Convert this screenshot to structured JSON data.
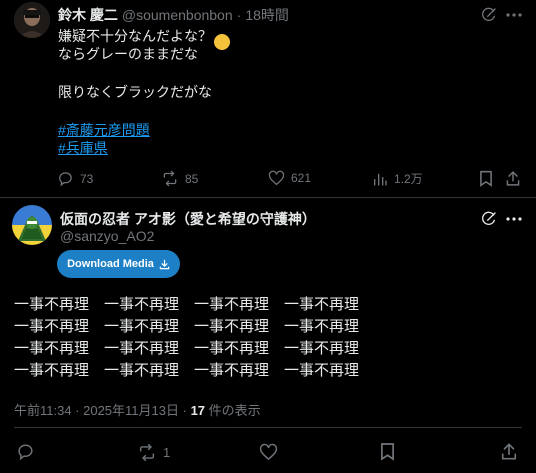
{
  "tweet1": {
    "display_name": "鈴木 慶二",
    "handle": "@soumenbonbon",
    "separator": "·",
    "time": "18時間",
    "line1": "嫌疑不十分なんだよな？",
    "line1_emoji": "🤔",
    "line2": "ならグレーのままだな",
    "line3": "限りなくブラックだがな",
    "hashtag1": "#斎藤元彦問題",
    "hashtag2": "#兵庫県",
    "replies": "73",
    "reposts": "85",
    "likes": "621",
    "views": "1.2万"
  },
  "tweet2": {
    "display_name": "仮面の忍者 アオ影（愛と希望の守護神）",
    "handle": "@sanzyo_AO2",
    "download_label": "Download Media",
    "body_lines": [
      "一事不再理　一事不再理　一事不再理　一事不再理",
      "一事不再理　一事不再理　一事不再理　一事不再理",
      "一事不再理　一事不再理　一事不再理　一事不再理",
      "一事不再理　一事不再理　一事不再理　一事不再理"
    ],
    "timestamp": "午前11:34 · 2025年11月13日 · ",
    "view_count": "17",
    "view_suffix": " 件の表示",
    "reposts": "1"
  },
  "colors": {
    "background": "#000000",
    "text": "#e7e9ea",
    "muted": "#71767b",
    "link": "#1d9bf0",
    "download_button": "#1d7fc6",
    "divider": "#2f3336"
  },
  "icons": {
    "grok": "grok-icon",
    "more": "more-icon",
    "reply": "reply-icon",
    "repost": "repost-icon",
    "like": "like-icon",
    "views": "views-icon",
    "bookmark": "bookmark-icon",
    "share": "share-icon",
    "download": "download-icon"
  }
}
